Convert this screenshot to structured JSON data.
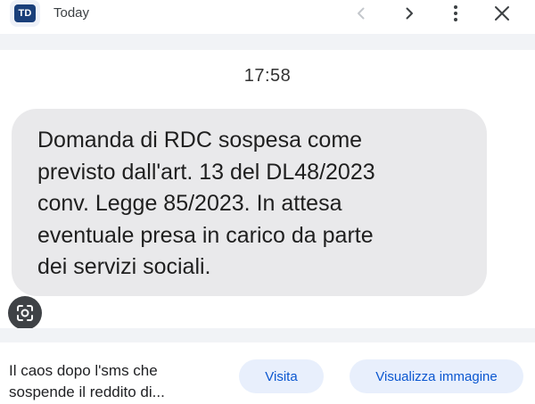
{
  "header": {
    "logo_text": "TD",
    "site_name": "Today",
    "icons": {
      "prev": "chevron-left-icon",
      "next": "chevron-right-icon",
      "more": "more-vert-icon",
      "close": "close-icon"
    }
  },
  "image": {
    "time": "17:58",
    "message_lines": [
      "Domanda di RDC sospesa come",
      "previsto dall'art. 13 del DL48/2023",
      "conv. Legge 85/2023. In attesa",
      "eventuale presa in carico da parte",
      "dei servizi sociali."
    ],
    "lens_icon": "lens-search-icon"
  },
  "caption": {
    "line1": "Il caos dopo l'sms che",
    "line2": "sospende il reddito di..."
  },
  "actions": {
    "visit_label": "Visita",
    "view_image_label": "Visualizza immagine"
  },
  "colors": {
    "bubble": "#e9e9eb",
    "accent": "#0b57d0",
    "button_bg": "#e8effc",
    "logo_bg": "#1a3f7a"
  }
}
